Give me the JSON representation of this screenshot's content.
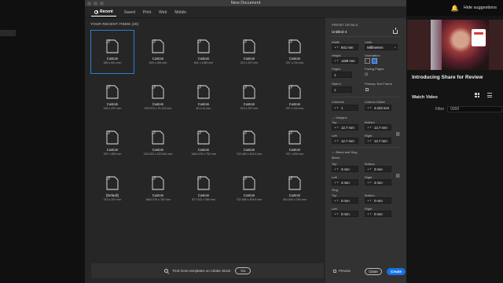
{
  "dialog": {
    "title": "New Document"
  },
  "tabs": [
    {
      "label": "Recent"
    },
    {
      "label": "Saved"
    },
    {
      "label": "Print"
    },
    {
      "label": "Web"
    },
    {
      "label": "Mobile"
    }
  ],
  "recent": {
    "heading": "YOUR RECENT ITEMS (20)",
    "items": [
      {
        "name": "Custom",
        "size": "584 x 841 mm"
      },
      {
        "name": "Custom",
        "size": "400 x 284 mm"
      },
      {
        "name": "Custom",
        "size": "841 x 1189 mm"
      },
      {
        "name": "Custom",
        "size": "210 x 297 mm"
      },
      {
        "name": "Custom",
        "size": "297 x 210 mm"
      },
      {
        "name": "Custom",
        "size": "150 x 297 mm"
      },
      {
        "name": "Custom",
        "size": "209.974 x 70.125 mm"
      },
      {
        "name": "Custom",
        "size": "60 x 41 mm"
      },
      {
        "name": "Custom",
        "size": "210 x 297 mm"
      },
      {
        "name": "Custom",
        "size": "297 x 210 mm"
      },
      {
        "name": "Custom",
        "size": "397 x 355 mm"
      },
      {
        "name": "Custom",
        "size": "432.533 x 232.544 mm"
      },
      {
        "name": "Custom",
        "size": "1664.078 x 762 mm"
      },
      {
        "name": "Custom",
        "size": "732.489 x 404.6 mm"
      },
      {
        "name": "Custom",
        "size": "297 x 600 mm"
      },
      {
        "name": "[Default]",
        "size": "210 x 297 mm"
      },
      {
        "name": "Custom",
        "size": "1664.078 x 762 mm"
      },
      {
        "name": "Custom",
        "size": "877.033 x 380 mm"
      },
      {
        "name": "Custom",
        "size": "732.489 x 404.6 mm"
      },
      {
        "name": "Custom",
        "size": "461.544 x 254 mm"
      }
    ]
  },
  "stock": {
    "text": "Find more templates on Adobe Stock",
    "go_label": "Go"
  },
  "preset": {
    "heading": "PRESET DETAILS",
    "name": "Untitled-4",
    "width_label": "Width",
    "width_value": "841 mm",
    "units_label": "Units",
    "units_value": "Millimeters",
    "height_label": "Height",
    "height_value": "1189 mm",
    "orientation_label": "Orientation",
    "pages_label": "Pages",
    "pages_value": "1",
    "facing_label": "Facing Pages",
    "start_label": "Start #",
    "start_value": "1",
    "primary_label": "Primary Text Frame",
    "columns_label": "Columns",
    "columns_value": "1",
    "gutter_label": "Column Gutter",
    "gutter_value": "4.233 mm",
    "margins_label": "Margins",
    "top_label": "Top",
    "bottom_label": "Bottom",
    "left_label": "Left",
    "right_label": "Right",
    "margin_top": "12.7 mm",
    "margin_bottom": "12.7 mm",
    "margin_left": "12.7 mm",
    "margin_right": "12.7 mm",
    "bleed_slug_label": "Bleed and Slug",
    "bleed_label": "Bleed",
    "bleed_top": "3 mm",
    "bleed_bottom": "3 mm",
    "bleed_left": "3 mm",
    "bleed_right": "3 mm",
    "slug_label": "Slug",
    "slug_top": "0 mm",
    "slug_bottom": "0 mm",
    "slug_left": "0 mm",
    "slug_right": "0 mm",
    "preview_label": "Preview",
    "close_label": "Close",
    "create_label": "Create"
  },
  "background": {
    "hide_suggestions": "Hide suggestions",
    "promo_title": "Introducing Share for Review",
    "promo_link": "Watch Video",
    "filter_label": "Filter",
    "filter_value": "0000"
  },
  "colors": {
    "accent": "#1473e6",
    "selection": "#2f7bd6"
  }
}
